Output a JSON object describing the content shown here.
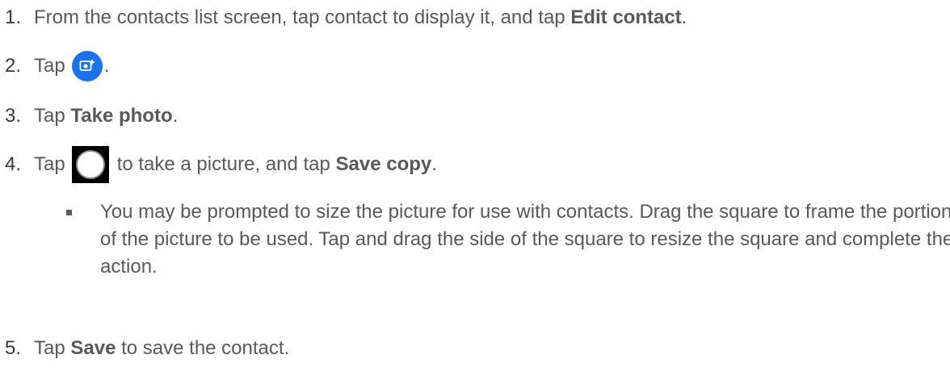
{
  "steps": [
    {
      "num": "1.",
      "pre": "From the contacts list screen, tap contact to display it, and tap ",
      "bold": "Edit contact",
      "post": "."
    },
    {
      "num": "2.",
      "pre": "Tap",
      "icon": "add-photo-icon",
      "post": "."
    },
    {
      "num": "3.",
      "pre": "Tap ",
      "bold": "Take photo",
      "post": "."
    },
    {
      "num": "4.",
      "pre": "Tap",
      "icon": "shutter-icon",
      "mid": "to take a picture, and tap ",
      "bold": "Save copy",
      "post": "."
    },
    {
      "num": "5.",
      "pre": "Tap ",
      "bold": "Save",
      "post": " to save the contact."
    }
  ],
  "sub_bullet": "You may be prompted to size the picture for use with contacts. Drag the square to frame the portion of the picture to be used. Tap and drag the side of the square to resize the square and complete the action.",
  "colors": {
    "text": "#595959",
    "icon_blue": "#1a73e8"
  }
}
